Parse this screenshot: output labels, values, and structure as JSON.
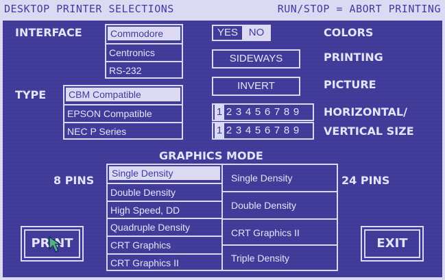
{
  "title_left": "DESKTOP PRINTER SELECTIONS",
  "title_right": "RUN/STOP = ABORT PRINTING",
  "interface": {
    "label": "INTERFACE",
    "options": [
      "Commodore",
      "Centronics",
      "RS-232"
    ],
    "selected": 0
  },
  "type": {
    "label": "TYPE",
    "options": [
      "CBM Compatible",
      "EPSON Compatible",
      "NEC P Series"
    ],
    "selected": 0
  },
  "colors": {
    "yes": "YES",
    "no": "NO",
    "selected": "NO",
    "label": "COLORS"
  },
  "printing": {
    "button": "SIDEWAYS",
    "label": "PRINTING"
  },
  "picture": {
    "button": "INVERT",
    "label": "PICTURE"
  },
  "horizontal": {
    "digits": [
      "1",
      "2",
      "3",
      "4",
      "5",
      "6",
      "7",
      "8",
      "9"
    ],
    "selected": "1",
    "label": "HORIZONTAL/"
  },
  "vertical": {
    "digits": [
      "1",
      "2",
      "3",
      "4",
      "5",
      "6",
      "7",
      "8",
      "9"
    ],
    "selected": "1",
    "label": "VERTICAL SIZE"
  },
  "graphics_mode": {
    "title": "GRAPHICS MODE",
    "pins8_label": "8 PINS",
    "pins24_label": "24 PINS",
    "pins8_options": [
      "Single Density",
      "Double Density",
      "High Speed, DD",
      "Quadruple Density",
      "CRT Graphics",
      "CRT Graphics II"
    ],
    "pins8_selected": 0,
    "pins24_options": [
      "Single Density",
      "Double Density",
      "CRT Graphics II",
      "Triple Density"
    ]
  },
  "print_label": "PRINT",
  "exit_label": "EXIT",
  "colors_theme": {
    "background": "#3f3a9e",
    "foreground": "#dcdaf3"
  }
}
